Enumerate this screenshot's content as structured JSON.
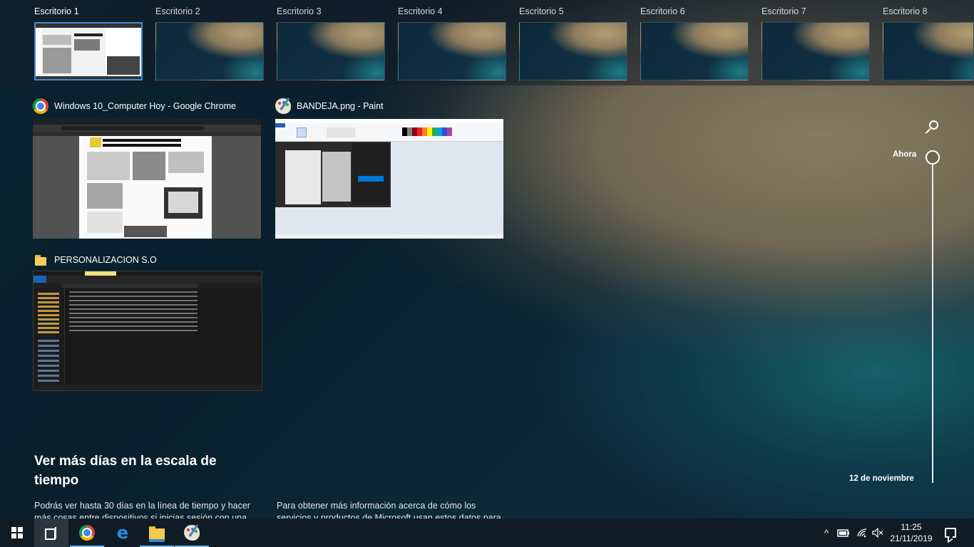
{
  "desktops": [
    {
      "label": "Escritorio 1",
      "active": true
    },
    {
      "label": "Escritorio 2",
      "active": false
    },
    {
      "label": "Escritorio 3",
      "active": false
    },
    {
      "label": "Escritorio 4",
      "active": false
    },
    {
      "label": "Escritorio 5",
      "active": false
    },
    {
      "label": "Escritorio 6",
      "active": false
    },
    {
      "label": "Escritorio 7",
      "active": false
    },
    {
      "label": "Escritorio 8",
      "active": false
    }
  ],
  "windows": {
    "chrome": {
      "title": "Windows 10_Computer Hoy - Google Chrome",
      "icon": "chrome-icon"
    },
    "paint": {
      "title": "BANDEJA.png - Paint",
      "icon": "paint-icon"
    },
    "explorer": {
      "title": "PERSONALIZACION S.O",
      "icon": "folder-icon"
    }
  },
  "timeline": {
    "now_label": "Ahora",
    "date_label": "12 de noviembre",
    "search_icon": "search-icon"
  },
  "promo": {
    "title": "Ver más días en la escala de tiempo",
    "text_left": "Podrás ver hasta 30 días en la línea de tiempo y hacer más cosas entre dispositivos si inicias sesión con una cuenta de",
    "text_right": "Para obtener más información acerca de cómo los servicios y productos de Microsoft usan estos datos para personalizar"
  },
  "taskbar": {
    "start_icon": "windows-logo-icon",
    "task_view_icon": "task-view-icon",
    "pinned": [
      "chrome-icon",
      "edge-icon",
      "file-explorer-icon",
      "paint-icon"
    ],
    "tray_chevron": "^",
    "time": "11:25",
    "date": "21/11/2019"
  },
  "colors": {
    "accent": "#3a8fd8",
    "taskbar": "#0f1c25",
    "running_indicator": "#76b9ed"
  }
}
